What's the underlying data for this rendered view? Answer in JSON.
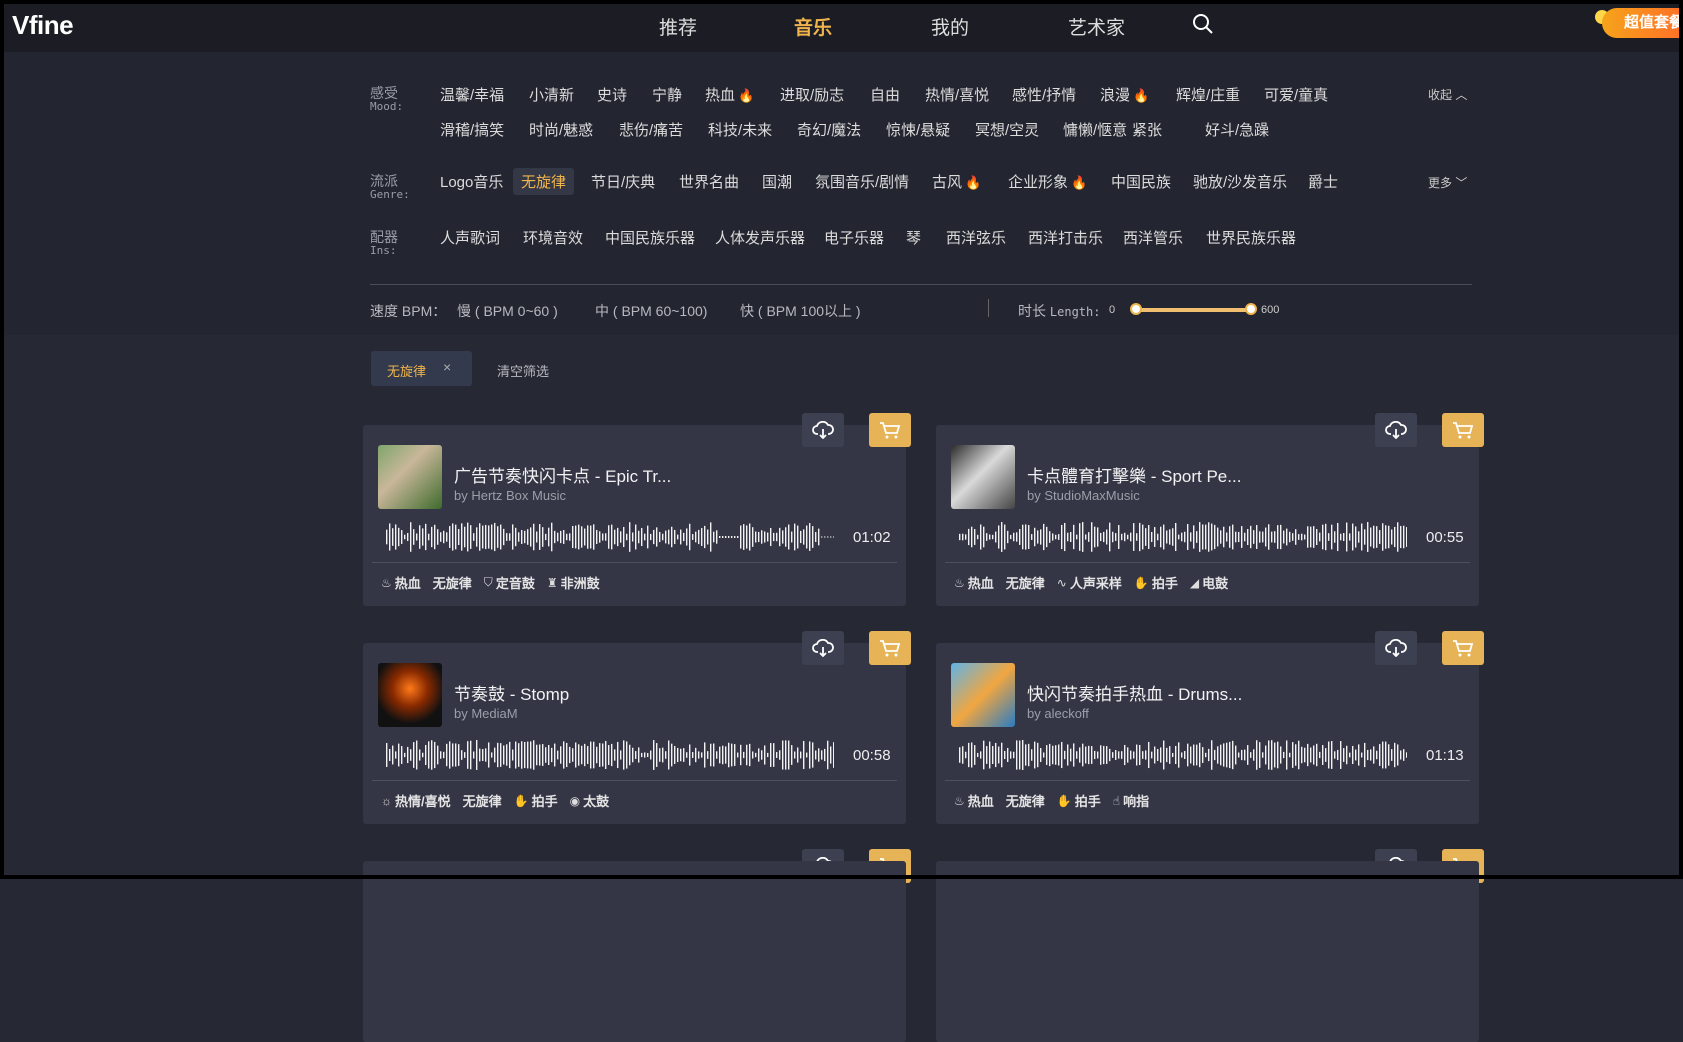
{
  "header": {
    "logo": "Vfine",
    "nav": [
      {
        "label": "推荐",
        "active": false
      },
      {
        "label": "音乐",
        "active": true
      },
      {
        "label": "我的",
        "active": false
      },
      {
        "label": "艺术家",
        "active": false
      }
    ],
    "promo": "超值套餐"
  },
  "filters": {
    "mood": {
      "label": "感受",
      "label_en": "Mood:",
      "row1": [
        "温馨/幸福",
        "小清新",
        "史诗",
        "宁静",
        "热血",
        "进取/励志",
        "自由",
        "热情/喜悦",
        "感性/抒情",
        "浪漫",
        "辉煌/庄重",
        "可爱/童真"
      ],
      "row2": [
        "滑稽/搞笑",
        "时尚/魅惑",
        "悲伤/痛苦",
        "科技/未来",
        "奇幻/魔法",
        "惊悚/悬疑",
        "冥想/空灵",
        "慵懒/惬意",
        "紧张",
        "好斗/急躁"
      ],
      "toggle": "收起"
    },
    "genre": {
      "label": "流派",
      "label_en": "Genre:",
      "items": [
        "Logo音乐",
        "无旋律",
        "节日/庆典",
        "世界名曲",
        "国潮",
        "氛围音乐/剧情",
        "古风",
        "企业形象",
        "中国民族",
        "驰放/沙发音乐",
        "爵士"
      ],
      "selected": "无旋律",
      "toggle": "更多"
    },
    "instrument": {
      "label": "配器",
      "label_en": "Ins:",
      "items": [
        "人声歌词",
        "环境音效",
        "中国民族乐器",
        "人体发声乐器",
        "电子乐器",
        "琴",
        "西洋弦乐",
        "西洋打击乐",
        "西洋管乐",
        "世界民族乐器"
      ]
    },
    "bpm": {
      "label": "速度 BPM：",
      "options": [
        "慢 ( BPM 0~60 )",
        "中 ( BPM 60~100)",
        "快 ( BPM 100以上 )"
      ]
    },
    "length": {
      "label": "时长",
      "label_en": "Length:",
      "min": "0",
      "max": "600",
      "range_start_pct": 0,
      "range_end_pct": 100
    }
  },
  "active_filter": {
    "label": "无旋律",
    "remove": "×"
  },
  "clear_filters": "清空筛选",
  "tracks": [
    {
      "title": "广告节奏快闪卡点 - Epic Tr...",
      "artist": "by Hertz Box Music",
      "duration": "01:02",
      "tags": [
        {
          "icon": "flame-icon",
          "text": "热血"
        },
        {
          "icon": "",
          "text": "无旋律"
        },
        {
          "icon": "drum-icon",
          "text": "定音鼓"
        },
        {
          "icon": "djembe-icon",
          "text": "非洲鼓"
        }
      ]
    },
    {
      "title": "卡点體育打擊樂 - Sport Pe...",
      "artist": "by StudioMaxMusic",
      "duration": "00:55",
      "tags": [
        {
          "icon": "flame-icon",
          "text": "热血"
        },
        {
          "icon": "",
          "text": "无旋律"
        },
        {
          "icon": "voice-wave-icon",
          "text": "人声采样"
        },
        {
          "icon": "clap-icon",
          "text": "拍手"
        },
        {
          "icon": "drum-pad-icon",
          "text": "电鼓"
        }
      ]
    },
    {
      "title": "节奏鼓 - Stomp",
      "artist": "by MediaM",
      "duration": "00:58",
      "tags": [
        {
          "icon": "sun-icon",
          "text": "热情/喜悦"
        },
        {
          "icon": "",
          "text": "无旋律"
        },
        {
          "icon": "clap-icon",
          "text": "拍手"
        },
        {
          "icon": "taiko-icon",
          "text": "太鼓"
        }
      ]
    },
    {
      "title": "快闪节奏拍手热血 - Drums...",
      "artist": "by aleckoff",
      "duration": "01:13",
      "tags": [
        {
          "icon": "flame-icon",
          "text": "热血"
        },
        {
          "icon": "",
          "text": "无旋律"
        },
        {
          "icon": "clap-icon",
          "text": "拍手"
        },
        {
          "icon": "snap-icon",
          "text": "响指"
        }
      ]
    }
  ]
}
